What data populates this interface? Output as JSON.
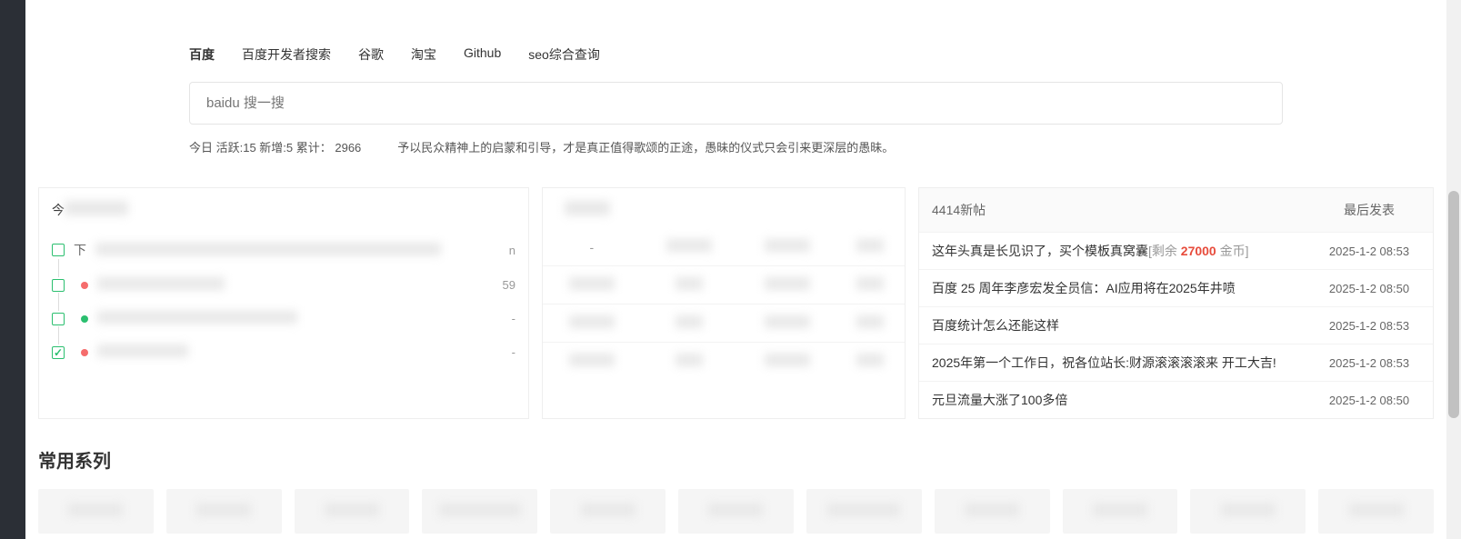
{
  "tabs": [
    {
      "label": "百度",
      "active": true
    },
    {
      "label": "百度开发者搜索",
      "active": false
    },
    {
      "label": "谷歌",
      "active": false
    },
    {
      "label": "淘宝",
      "active": false
    },
    {
      "label": "Github",
      "active": false
    },
    {
      "label": "seo综合查询",
      "active": false
    }
  ],
  "search": {
    "placeholder": "baidu 搜一搜"
  },
  "stats": {
    "line": "今日 活跃:15 新增:5 累计： 2966",
    "quote": "予以民众精神上的启蒙和引导，才是真正值得歌颂的正途，愚昧的仪式只会引来更深层的愚昧。"
  },
  "left_panel": {
    "header_prefix": "今",
    "items": [
      {
        "checked": false,
        "dot": null,
        "right": "n",
        "right2": ""
      },
      {
        "checked": false,
        "dot": "red",
        "right": "",
        "right2": "59"
      },
      {
        "checked": false,
        "dot": "green",
        "right": "-",
        "right2": ""
      },
      {
        "checked": true,
        "dot": "red",
        "right": "-",
        "right2": ""
      }
    ]
  },
  "mid_panel": {
    "rows": [
      [
        "-",
        "",
        "",
        ""
      ],
      [
        "",
        "",
        "",
        ""
      ],
      [
        "",
        "",
        "",
        ""
      ],
      [
        "",
        "",
        "",
        ""
      ]
    ]
  },
  "forum": {
    "header_title": "4414新帖",
    "header_time": "最后发表",
    "posts": [
      {
        "title": "这年头真是长见识了，买个模板真窝囊",
        "extra": "[剩余 27000 金币]",
        "time": "2025-1-2 08:53"
      },
      {
        "title": "百度 25 周年李彦宏发全员信：AI应用将在2025年井喷",
        "extra": "",
        "time": "2025-1-2 08:50"
      },
      {
        "title": "百度统计怎么还能这样",
        "extra": "",
        "time": "2025-1-2 08:53"
      },
      {
        "title": "2025年第一个工作日，祝各位站长:财源滚滚滚滚来 开工大吉!",
        "extra": "",
        "time": "2025-1-2 08:53"
      },
      {
        "title": "元旦流量大涨了100多倍",
        "extra": "",
        "time": "2025-1-2 08:50"
      }
    ]
  },
  "section": {
    "title": "常用系列"
  },
  "sites": [
    {},
    {},
    {},
    {},
    {},
    {},
    {},
    {},
    {},
    {},
    {}
  ]
}
